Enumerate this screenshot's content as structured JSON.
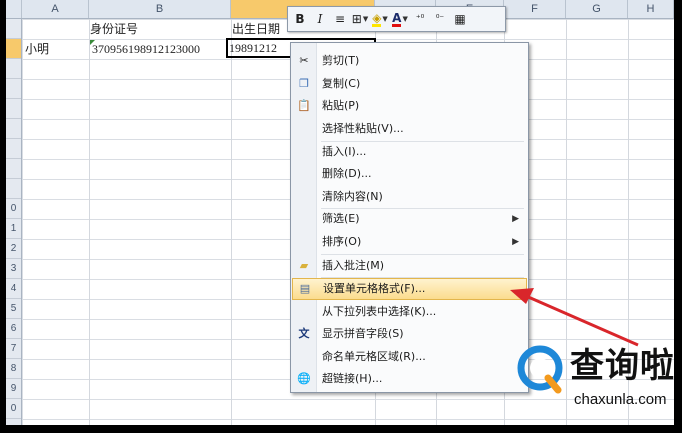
{
  "columns": [
    {
      "id": "A",
      "label": "A"
    },
    {
      "id": "B",
      "label": "B"
    },
    {
      "id": "C",
      "label": ""
    },
    {
      "id": "D",
      "label": ""
    },
    {
      "id": "E",
      "label": "E"
    },
    {
      "id": "F",
      "label": "F"
    },
    {
      "id": "G",
      "label": "G"
    },
    {
      "id": "H",
      "label": "H"
    }
  ],
  "rows": [
    "",
    "",
    "",
    "",
    "",
    "",
    "",
    "",
    "",
    "0",
    "1",
    "2",
    "3",
    "4",
    "5",
    "6",
    "7",
    "8",
    "9",
    "0"
  ],
  "cells": {
    "b1": "身份证号",
    "c1": "出生日期",
    "a2": "小明",
    "b2": "370956198912123000",
    "c2": "19891212"
  },
  "mini_toolbar": {
    "bold": "B",
    "italic": "I",
    "align": "≡",
    "borders": "⊞",
    "fill": "◈",
    "font_color": "A",
    "inc_decimal": "⁺⁰",
    "dec_decimal": "⁰⁻",
    "format": "▦"
  },
  "menu": {
    "cut": "剪切(T)",
    "copy": "复制(C)",
    "paste": "粘贴(P)",
    "paste_special": "选择性粘贴(V)...",
    "insert": "插入(I)...",
    "delete": "删除(D)...",
    "clear": "清除内容(N)",
    "filter": "筛选(E)",
    "sort": "排序(O)",
    "insert_comment": "插入批注(M)",
    "format_cells": "设置单元格格式(F)...",
    "pick_list": "从下拉列表中选择(K)...",
    "phonetic": "显示拼音字段(S)",
    "name_range": "命名单元格区域(R)...",
    "hyperlink": "超链接(H)...",
    "submenu_arrow": "▶"
  },
  "watermark": {
    "cn": "查询啦",
    "en": "chaxunla.com"
  },
  "colors": {
    "highlight": "#fbdc8e",
    "arrow": "#d9262b",
    "logo_blue": "#1e88d8",
    "logo_orange": "#f39a1e"
  }
}
